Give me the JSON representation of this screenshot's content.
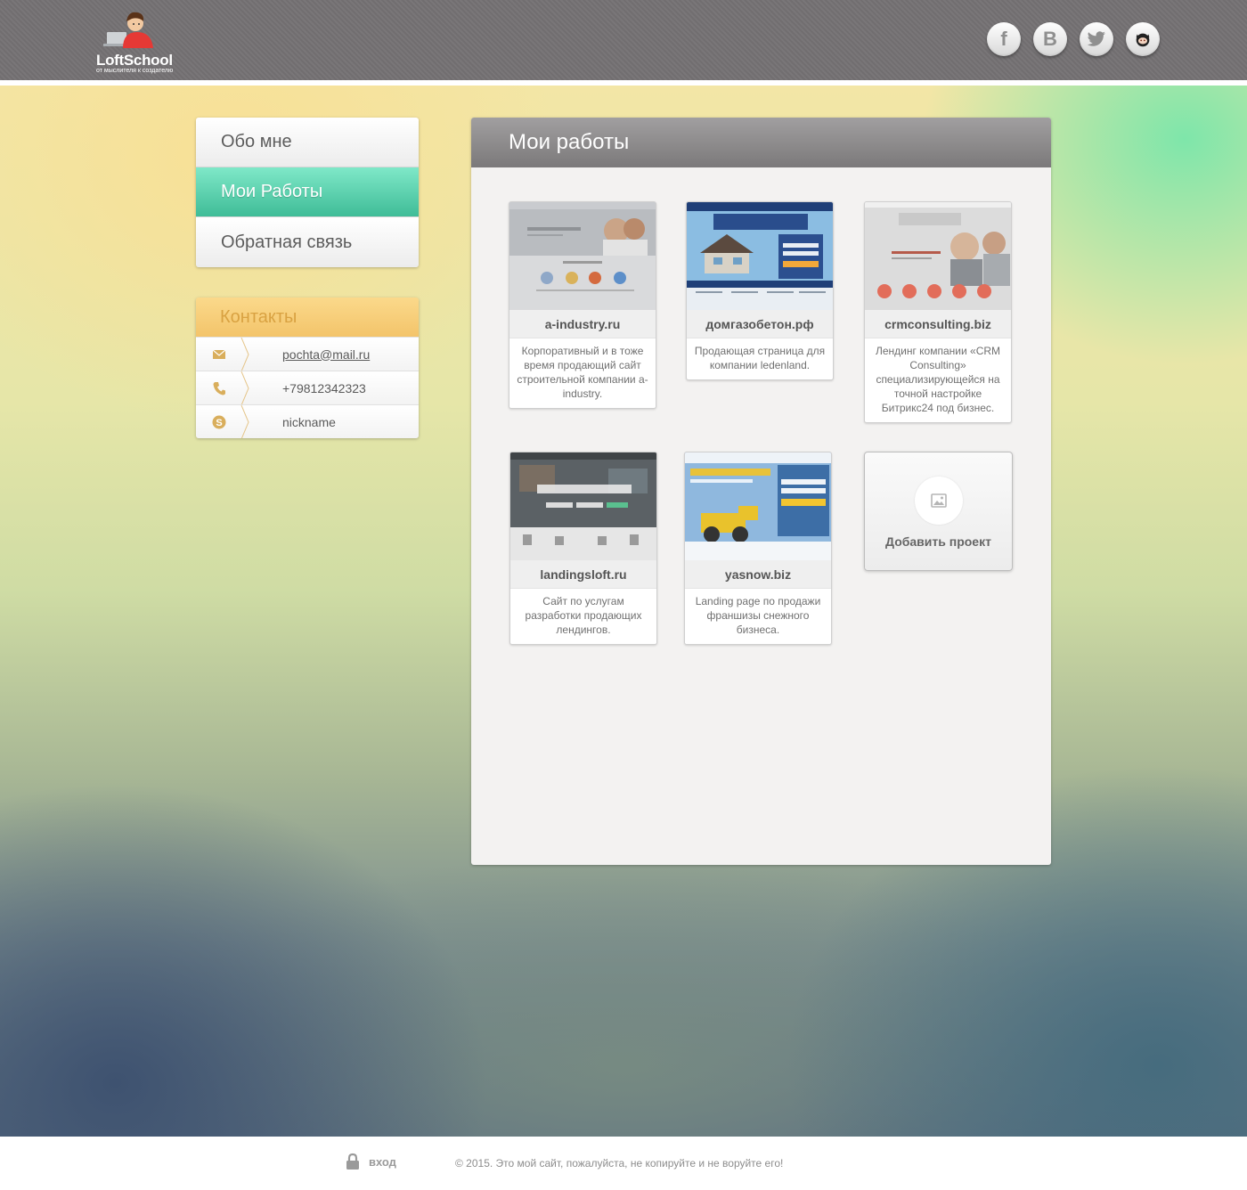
{
  "header": {
    "logo_title": "LoftSchool",
    "logo_subtitle": "от мыслителя к создателю",
    "socials": [
      {
        "name": "facebook",
        "glyph": "f"
      },
      {
        "name": "vk",
        "glyph": "B"
      },
      {
        "name": "twitter",
        "glyph": ""
      },
      {
        "name": "github",
        "glyph": ""
      }
    ]
  },
  "nav": {
    "items": [
      {
        "label": "Обо мне",
        "active": false
      },
      {
        "label": "Мои Работы",
        "active": true
      },
      {
        "label": "Обратная связь",
        "active": false
      }
    ]
  },
  "contacts": {
    "title": "Контакты",
    "email": "pochta@mail.ru",
    "phone": "+79812342323",
    "skype": "nickname"
  },
  "main": {
    "title": "Мои работы",
    "works": [
      {
        "title": "a-industry.ru",
        "desc": "Корпоративный и в тоже время продающий сайт строительной компании a-industry."
      },
      {
        "title": "домгазобетон.рф",
        "desc": "Продающая страница для компании ledenland."
      },
      {
        "title": "crmconsulting.biz",
        "desc": "Лендинг компании «CRM Consulting» специализирующейся на точной настройке Битрикс24 под бизнес."
      },
      {
        "title": "landingsloft.ru",
        "desc": "Сайт по услугам разработки продающих лендингов."
      },
      {
        "title": "yasnow.biz",
        "desc": "Landing page по продажи франшизы снежного бизнеса."
      }
    ],
    "add_label": "Добавить проект"
  },
  "footer": {
    "login_label": "вход",
    "copyright": "© 2015. Это мой сайт, пожалуйста, не копируйте и не воруйте его!"
  }
}
